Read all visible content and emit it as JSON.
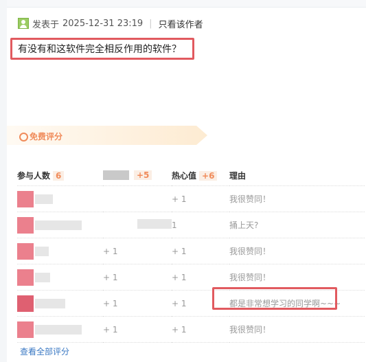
{
  "post": {
    "meta_prefix": "发表于",
    "date": "2025-12-31 23:19",
    "separator": "|",
    "only_author": "只看该作者",
    "content": "有没有和这软件完全相反作用的软件？"
  },
  "rating": {
    "section_title": "免费评分",
    "headers": {
      "participants": "参与人数",
      "participants_count": "6",
      "col2_count": "+5",
      "heat": "热心值",
      "heat_count": "+6",
      "reason": "理由"
    },
    "rows": [
      {
        "col2": "",
        "heat": "+ 1",
        "reason": "我很赞同！"
      },
      {
        "col2": "",
        "heat": "1",
        "reason": "捅上天?"
      },
      {
        "col2": "+ 1",
        "heat": "+ 1",
        "reason": "我很赞同！"
      },
      {
        "col2": "+ 1",
        "heat": "+ 1",
        "reason": "我很赞同！"
      },
      {
        "col2": "+ 1",
        "heat": "+ 1",
        "reason": "都是非常想学习的同学啊~~~"
      },
      {
        "col2": "+ 1",
        "heat": "+ 1",
        "reason": "我很赞同！"
      }
    ],
    "view_all": "查看全部评分"
  },
  "colors": {
    "accent_orange": "#f08b5a",
    "highlight_red": "#e15a5f",
    "link_blue": "#3a78c3"
  },
  "icons": [
    "user-avatar-icon",
    "rating-circle-icon"
  ]
}
